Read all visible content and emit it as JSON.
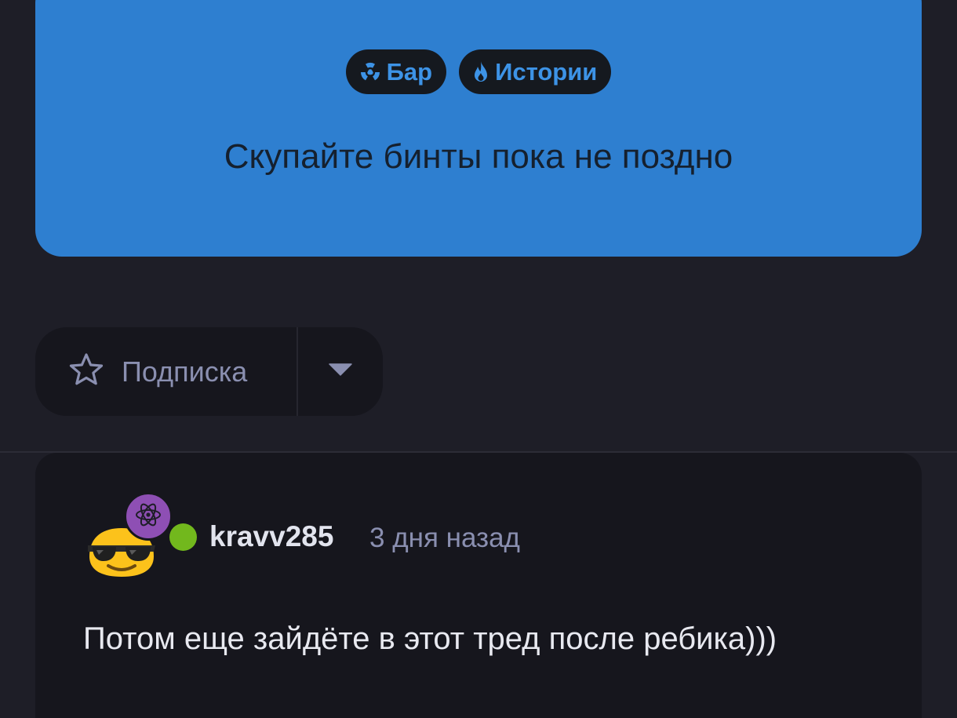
{
  "post": {
    "tags": [
      {
        "label": "Бар",
        "icon": "radiation-icon"
      },
      {
        "label": "Истории",
        "icon": "flame-icon"
      }
    ],
    "text": "Скупайте бинты пока не поздно"
  },
  "subscribe": {
    "label": "Подписка",
    "icon": "star-outline-icon",
    "dropdown_icon": "caret-down-icon"
  },
  "comment": {
    "avatar_icon": "sunglasses-emoji-icon",
    "badge_icon": "atom-icon",
    "online": true,
    "username": "kravv285",
    "timestamp": "3 дня назад",
    "text": "Потом еще зайдёте в этот тред после ребика)))"
  },
  "colors": {
    "background": "#1e1e27",
    "post_card": "#2e7fd0",
    "tag_bg": "#15191f",
    "tag_text": "#3d93e6",
    "card_dark": "#16161d",
    "muted_text": "#8a8fb0",
    "online": "#72b81d",
    "badge": "#8e4fb4"
  }
}
